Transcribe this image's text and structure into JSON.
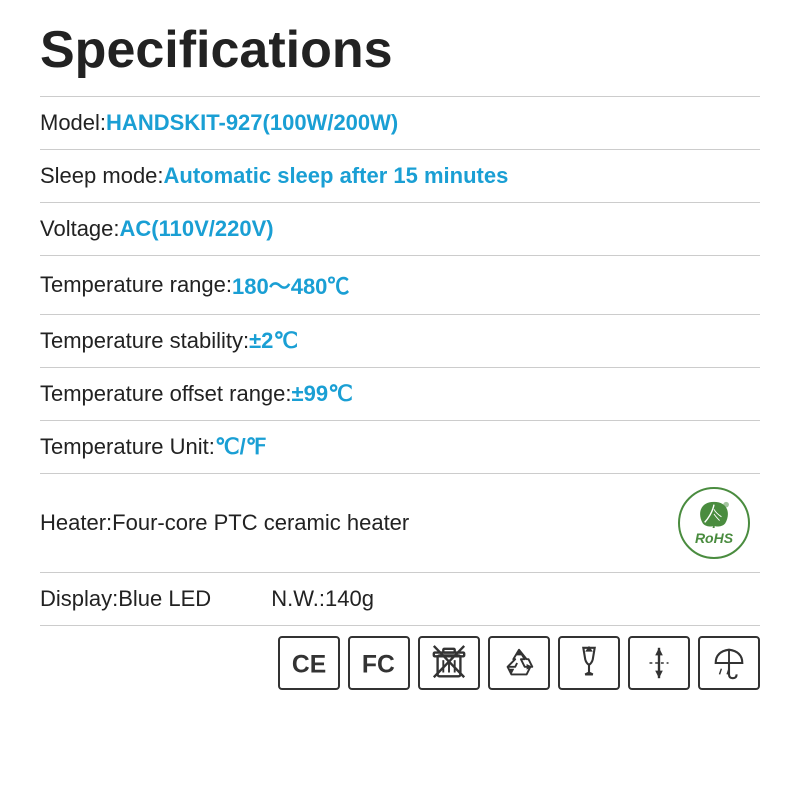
{
  "title": "Specifications",
  "specs": [
    {
      "label": "Model:",
      "value": "HANDSKIT-927(100W/200W)"
    },
    {
      "label": "Sleep mode:",
      "value": "Automatic sleep after 15 minutes"
    },
    {
      "label": "Voltage:",
      "value": "AC(110V/220V)"
    },
    {
      "label": "Temperature range:",
      "value": "180～480℃"
    },
    {
      "label": "Temperature stability:",
      "value": "±2℃"
    },
    {
      "label": "Temperature offset range:",
      "value": "±99℃"
    },
    {
      "label": "Temperature Unit:",
      "value": "℃/℉"
    }
  ],
  "heater_label": "Heater: ",
  "heater_value": "Four-core PTC ceramic heater",
  "display_label": "Display:",
  "display_value": "Blue LED",
  "nw_label": "N.W.:",
  "nw_value": "140g",
  "cert_icons": [
    "CE",
    "FC",
    "WEEE",
    "Recycle",
    "Fragile",
    "Weight",
    "Umbrella"
  ],
  "rohs_text": "RoHS",
  "accent_color": "#1a9fd4",
  "rohs_color": "#4a8c3f"
}
